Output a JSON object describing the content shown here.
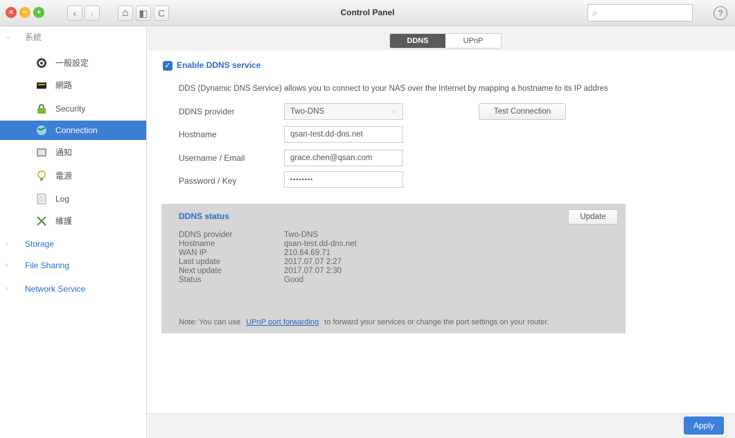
{
  "window": {
    "title": "Control Panel",
    "search_placeholder": ""
  },
  "toolbar": {
    "back_icon": "‹",
    "forward_icon": "›",
    "home_icon": "⌂",
    "panel_icon": "◧",
    "refresh_icon": "C",
    "search_icon": "⌕",
    "help_icon": "?"
  },
  "sidebar": {
    "system_section": "系統",
    "items": [
      {
        "label": "一般設定",
        "icon": "gear-icon"
      },
      {
        "label": "網路",
        "icon": "network-icon"
      },
      {
        "label": "Security",
        "icon": "lock-icon"
      },
      {
        "label": "Connection",
        "icon": "globe-icon"
      },
      {
        "label": "通知",
        "icon": "notification-icon"
      },
      {
        "label": "電源",
        "icon": "bulb-icon"
      },
      {
        "label": "Log",
        "icon": "log-icon"
      },
      {
        "label": "維護",
        "icon": "tools-icon"
      }
    ],
    "storage": "Storage",
    "file_sharing": "File Sharing",
    "network_service": "Network Service"
  },
  "tabs": {
    "ddns": "DDNS",
    "upnp": "UPnP"
  },
  "ddns": {
    "enable_label": "Enable DDNS service",
    "description": "DDS (Dynamic DNS Service) allows you to connect to your NAS over the Internet by mapping a hostname to its IP addres",
    "provider_label": "DDNS provider",
    "provider_value": "Two-DNS",
    "hostname_label": "Hostname",
    "hostname_value": "qsan-test.dd-dns.net",
    "username_label": "Username / Email",
    "username_value": "grace.chen@qsan.com",
    "password_label": "Password / Key",
    "password_value": "••••••••",
    "test_button": "Test Connection"
  },
  "status": {
    "title": "DDNS status",
    "update_button": "Update",
    "rows": [
      {
        "label": "DDNS provider",
        "value": "Two-DNS"
      },
      {
        "label": "Hostname",
        "value": "qsan-test.dd-dns.net"
      },
      {
        "label": "WAN IP",
        "value": "210.64.69.71"
      },
      {
        "label": "Last update",
        "value": "2017.07.07 2:27"
      },
      {
        "label": "Next update",
        "value": "2017.07.07 2:30"
      },
      {
        "label": "Status",
        "value": "Good"
      }
    ],
    "note_prefix": "Note: You can use",
    "note_link": "UPnP port forwarding",
    "note_suffix": "to forward your services or change the port settings on your router."
  },
  "footer": {
    "apply_button": "Apply"
  },
  "colors": {
    "accent": "#3d7fd4",
    "link": "#2b6cc4",
    "status_bg": "#d6d6d6"
  }
}
